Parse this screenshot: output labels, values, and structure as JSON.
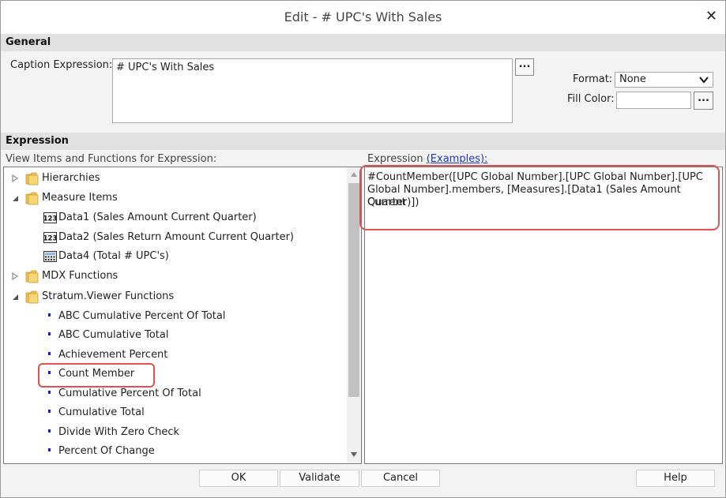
{
  "dialog": {
    "title": "Edit - # UPC's With Sales",
    "close_glyph": "✕"
  },
  "general": {
    "header": "General",
    "caption_label": "Caption Expression:",
    "caption_value": "# UPC's With Sales",
    "browse_label": "...",
    "format_label": "Format:",
    "format_value": "None",
    "fill_color_label": "Fill Color:",
    "fill_color_value": "",
    "fill_browse_label": "..."
  },
  "expression": {
    "header": "Expression",
    "items_label": "View Items and Functions for Expression:",
    "expr_label": "Expression",
    "examples_link": "(Examples)",
    "expr_colon": ":",
    "expr_lines": [
      "#CountMember([UPC Global Number].[UPC Global Number].[UPC",
      "Global Number].members, [Measures].[Data1 (Sales Amount Current",
      "Quarter)])"
    ]
  },
  "tree": {
    "items": [
      {
        "label": "Hierarchies",
        "type": "folder",
        "expander": "collapsed"
      },
      {
        "label": "Measure Items",
        "type": "folder",
        "expander": "expanded"
      },
      {
        "label": "Data1 (Sales Amount Current Quarter)",
        "type": "data",
        "icon": "123-icon"
      },
      {
        "label": "Data2 (Sales Return Amount Current Quarter)",
        "type": "data",
        "icon": "123-icon"
      },
      {
        "label": "Data4 (Total # UPC's)",
        "type": "data",
        "icon": "calculator-icon"
      },
      {
        "label": "MDX Functions",
        "type": "folder",
        "expander": "collapsed"
      },
      {
        "label": "Stratum.Viewer Functions",
        "type": "folder",
        "expander": "expanded"
      },
      {
        "label": "ABC Cumulative Percent Of Total",
        "type": "function"
      },
      {
        "label": "ABC Cumulative Total",
        "type": "function"
      },
      {
        "label": "Achievement Percent",
        "type": "function"
      },
      {
        "label": "Count Member",
        "type": "function"
      },
      {
        "label": "Cumulative Percent Of Total",
        "type": "function"
      },
      {
        "label": "Cumulative Total",
        "type": "function"
      },
      {
        "label": "Divide With Zero Check",
        "type": "function"
      },
      {
        "label": "Percent Of Change",
        "type": "function"
      }
    ]
  },
  "buttons": {
    "ok": "OK",
    "validate": "Validate",
    "cancel": "Cancel",
    "help": "Help"
  },
  "colors": {
    "highlight_border": "#e05252",
    "link": "#1a35d6",
    "function_bullet": "#1a1ad6",
    "folder": "#f2c14e"
  }
}
